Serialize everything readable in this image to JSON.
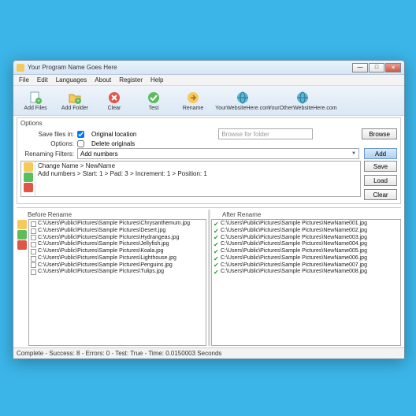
{
  "window": {
    "title": "Your Program Name Goes Here"
  },
  "menu": {
    "file": "File",
    "edit": "Edit",
    "languages": "Languages",
    "about": "About",
    "register": "Register",
    "help": "Help"
  },
  "toolbar": {
    "addFiles": "Add Files",
    "addFolder": "Add Folder",
    "clear": "Clear",
    "test": "Test",
    "rename": "Rename",
    "site1": "YourWebsiteHere.com",
    "site2": "YourOtherWebsiteHere.com"
  },
  "options": {
    "legend": "Options",
    "saveFilesLabel": "Save files in:",
    "original": "Original location",
    "browsePlaceholder": "Browse for folder",
    "browseBtn": "Browse",
    "optionsLabel": "Options:",
    "deleteOriginals": "Delete originals",
    "renameLabel": "Renaming Filters:",
    "dropdown": "Add numbers",
    "addBtn": "Add",
    "saveBtn": "Save",
    "loadBtn": "Load",
    "clearBtn": "Clear",
    "filterLine1": "Change Name > NewName",
    "filterLine2": "Add numbers > Start: 1 > Pad: 3 > Increment: 1 > Position: 1"
  },
  "before": {
    "label": "Before Rename",
    "items": [
      "C:\\Users\\Public\\Pictures\\Sample Pictures\\Chrysanthemum.jpg",
      "C:\\Users\\Public\\Pictures\\Sample Pictures\\Desert.jpg",
      "C:\\Users\\Public\\Pictures\\Sample Pictures\\Hydrangeas.jpg",
      "C:\\Users\\Public\\Pictures\\Sample Pictures\\Jellyfish.jpg",
      "C:\\Users\\Public\\Pictures\\Sample Pictures\\Koala.jpg",
      "C:\\Users\\Public\\Pictures\\Sample Pictures\\Lighthouse.jpg",
      "C:\\Users\\Public\\Pictures\\Sample Pictures\\Penguins.jpg",
      "C:\\Users\\Public\\Pictures\\Sample Pictures\\Tulips.jpg"
    ]
  },
  "after": {
    "label": "After Rename",
    "items": [
      "C:\\Users\\Public\\Pictures\\Sample Pictures\\NewName001.jpg",
      "C:\\Users\\Public\\Pictures\\Sample Pictures\\NewName002.jpg",
      "C:\\Users\\Public\\Pictures\\Sample Pictures\\NewName003.jpg",
      "C:\\Users\\Public\\Pictures\\Sample Pictures\\NewName004.jpg",
      "C:\\Users\\Public\\Pictures\\Sample Pictures\\NewName005.jpg",
      "C:\\Users\\Public\\Pictures\\Sample Pictures\\NewName006.jpg",
      "C:\\Users\\Public\\Pictures\\Sample Pictures\\NewName007.jpg",
      "C:\\Users\\Public\\Pictures\\Sample Pictures\\NewName008.jpg"
    ]
  },
  "status": "Complete - Success: 8 - Errors: 0 - Test: True - Time: 0.0150003 Seconds"
}
